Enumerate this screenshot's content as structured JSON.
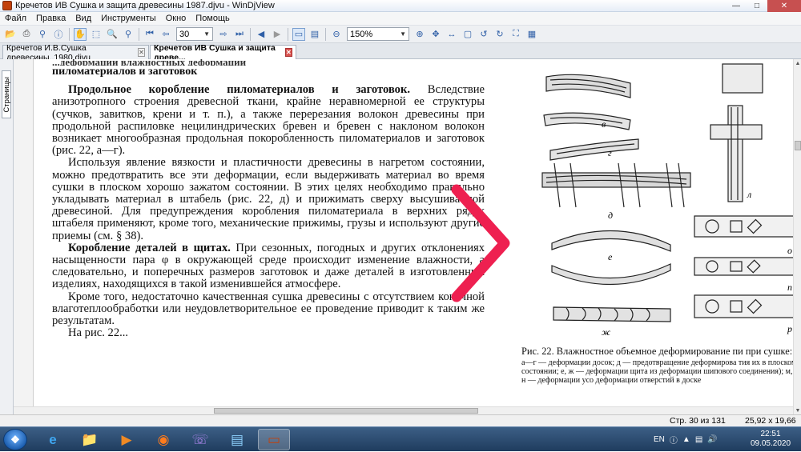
{
  "window": {
    "title": "Кречетов ИВ Сушка и защита древесины 1987.djvu - WinDjView"
  },
  "menu": [
    "Файл",
    "Правка",
    "Вид",
    "Инструменты",
    "Окно",
    "Помощь"
  ],
  "toolbar": {
    "page_value": "30",
    "zoom_value": "150%"
  },
  "tabs": [
    {
      "label": "Кречетов И.В.Сушка древесины..1980.djvu"
    },
    {
      "label": "Кречетов ИВ Сушка и защита древе..."
    }
  ],
  "sidebar": {
    "pages_tab": "Страницы"
  },
  "document": {
    "cut_line": "...деформации влажностных деформации",
    "heading": "пиломатериалов и заготовок",
    "paragraphs": [
      {
        "bold": "Продольное коробление пиломатериалов и заготовок.",
        "text": " Вследствие анизотропного строения древесной ткани, крайне неравномерной ее структуры (сучков, завитков, крени и т. п.), а также перерезания волокон древесины при продольной распиловке нецилиндрических бревен и бревен с наклоном волокон возникает многообразная продольная покоробленность пиломатериалов и заготовок (рис. 22, а—г)."
      },
      {
        "bold": "",
        "text": "Используя явление вязкости и пластичности древесины в нагретом состоянии, можно предотвратить все эти деформации, если выдерживать материал во время сушки в плоском хорошо зажатом состоянии. В этих целях необходимо правильно укладывать материал в штабель (рис. 22, д) и прижимать сверху высушиваемой древесиной. Для предупреждения коробления пиломатериала в верхних рядах штабеля применяют, кроме того, механические прижимы, грузы и используют другие приемы (см. § 38)."
      },
      {
        "bold": "Коробление деталей в щитах.",
        "text": " При сезонных, погодных и других отклонениях насыщенности пара φ в окружающей среде происходит изменение влажности, а следовательно, и поперечных размеров заготовок и даже деталей в изготовленных изделиях, находящихся в такой изменившейся атмосфере."
      },
      {
        "bold": "",
        "text": "Кроме того, недостаточно качественная сушка древесины с отсутствием конечной влаготеплообработки или неудовлетворительное ее проведение приводит к таким же результатам."
      }
    ],
    "bottom_cut": "На рис. 22..."
  },
  "figure": {
    "labels": [
      "в",
      "г",
      "д",
      "е",
      "ж",
      "л",
      "о",
      "п",
      "р"
    ],
    "caption_title": "Рис. 22. Влажностное объемное деформирование пи при сушке:",
    "caption_lines": [
      "а—г — деформации досок; д — предотвращение деформирова тия их в плоском состоянии; е, ж — деформации щита из деформации шипового соединения); м, н — деформации усо деформации отверстий в доске"
    ]
  },
  "status": {
    "page": "Стр. 30 из 131",
    "size": "25,92 x 19,66 см"
  },
  "taskbar": {
    "lang": "EN",
    "time": "22:51",
    "date": "09.05.2020"
  },
  "colors": {
    "arrow": "#ee2050",
    "taskbar": "#1f3c5e",
    "close": "#c75050"
  }
}
